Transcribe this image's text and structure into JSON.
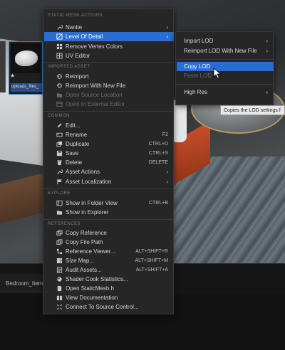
{
  "viewport": {},
  "content_browser": {
    "tab_label": "Bedroom_Item",
    "asset_tile_label": "uploads_files_"
  },
  "menu": {
    "sections": {
      "static_mesh_actions": "STATIC MESH ACTIONS",
      "imported_asset": "IMPORTED ASSET",
      "common": "COMMON",
      "explore": "EXPLORE",
      "references": "REFERENCES"
    },
    "items": {
      "nanite": "Nanite",
      "level_of_detail": "Level Of Detail",
      "remove_vertex_colors": "Remove Vertex Colors",
      "uv_editor": "UV Editor",
      "reimport": "Reimport",
      "reimport_with_new_file": "Reimport With New File",
      "open_source_location": "Open Source Location",
      "open_in_external_editor": "Open In External Editor",
      "edit": "Edit...",
      "rename": "Rename",
      "duplicate": "Duplicate",
      "save": "Save",
      "delete": "Delete",
      "asset_actions": "Asset Actions",
      "asset_localization": "Asset Localization",
      "show_in_folder_view": "Show in Folder View",
      "show_in_explorer": "Show in Explorer",
      "copy_reference": "Copy Reference",
      "copy_file_path": "Copy File Path",
      "reference_viewer": "Reference Viewer...",
      "size_map": "Size Map...",
      "audit_assets": "Audit Assets...",
      "shader_cook_statistics": "Shader Cook Statistics...",
      "open_staticmesh_h": "Open StaticMesh.h",
      "view_documentation": "View Documentation",
      "connect_to_source_control": "Connect To Source Control..."
    },
    "shortcuts": {
      "rename": "F2",
      "duplicate": "CTRL+D",
      "save": "CTRL+S",
      "delete": "DELETE",
      "show_in_folder_view": "CTRL+B",
      "reference_viewer": "ALT+SHIFT+R",
      "size_map": "ALT+SHIFT+M",
      "audit_assets": "ALT+SHIFT+A"
    }
  },
  "submenu": {
    "import_lod": "Import LOD",
    "reimport_lod_with_new_file": "Reimport LOD With New File",
    "copy_lod": "Copy LOD",
    "paste_lod": "Paste LOD",
    "high_res": "High Res"
  },
  "tooltip": {
    "text": "Copies the LOD settings f"
  },
  "colors": {
    "highlight": "#2a6dd2",
    "menu_bg": "#262626",
    "disabled_text": "#6a6a6a"
  }
}
